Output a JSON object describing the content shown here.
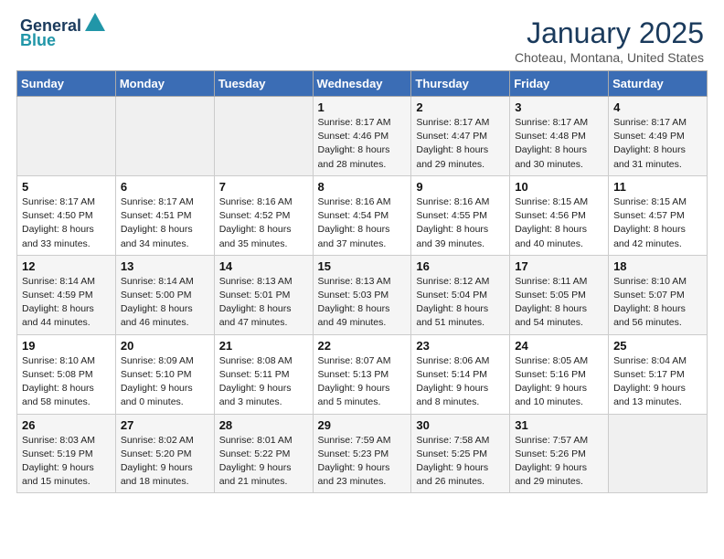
{
  "header": {
    "logo_line1": "General",
    "logo_line2": "Blue",
    "month": "January 2025",
    "location": "Choteau, Montana, United States"
  },
  "days_of_week": [
    "Sunday",
    "Monday",
    "Tuesday",
    "Wednesday",
    "Thursday",
    "Friday",
    "Saturday"
  ],
  "weeks": [
    [
      {
        "day": "",
        "info": ""
      },
      {
        "day": "",
        "info": ""
      },
      {
        "day": "",
        "info": ""
      },
      {
        "day": "1",
        "info": "Sunrise: 8:17 AM\nSunset: 4:46 PM\nDaylight: 8 hours\nand 28 minutes."
      },
      {
        "day": "2",
        "info": "Sunrise: 8:17 AM\nSunset: 4:47 PM\nDaylight: 8 hours\nand 29 minutes."
      },
      {
        "day": "3",
        "info": "Sunrise: 8:17 AM\nSunset: 4:48 PM\nDaylight: 8 hours\nand 30 minutes."
      },
      {
        "day": "4",
        "info": "Sunrise: 8:17 AM\nSunset: 4:49 PM\nDaylight: 8 hours\nand 31 minutes."
      }
    ],
    [
      {
        "day": "5",
        "info": "Sunrise: 8:17 AM\nSunset: 4:50 PM\nDaylight: 8 hours\nand 33 minutes."
      },
      {
        "day": "6",
        "info": "Sunrise: 8:17 AM\nSunset: 4:51 PM\nDaylight: 8 hours\nand 34 minutes."
      },
      {
        "day": "7",
        "info": "Sunrise: 8:16 AM\nSunset: 4:52 PM\nDaylight: 8 hours\nand 35 minutes."
      },
      {
        "day": "8",
        "info": "Sunrise: 8:16 AM\nSunset: 4:54 PM\nDaylight: 8 hours\nand 37 minutes."
      },
      {
        "day": "9",
        "info": "Sunrise: 8:16 AM\nSunset: 4:55 PM\nDaylight: 8 hours\nand 39 minutes."
      },
      {
        "day": "10",
        "info": "Sunrise: 8:15 AM\nSunset: 4:56 PM\nDaylight: 8 hours\nand 40 minutes."
      },
      {
        "day": "11",
        "info": "Sunrise: 8:15 AM\nSunset: 4:57 PM\nDaylight: 8 hours\nand 42 minutes."
      }
    ],
    [
      {
        "day": "12",
        "info": "Sunrise: 8:14 AM\nSunset: 4:59 PM\nDaylight: 8 hours\nand 44 minutes."
      },
      {
        "day": "13",
        "info": "Sunrise: 8:14 AM\nSunset: 5:00 PM\nDaylight: 8 hours\nand 46 minutes."
      },
      {
        "day": "14",
        "info": "Sunrise: 8:13 AM\nSunset: 5:01 PM\nDaylight: 8 hours\nand 47 minutes."
      },
      {
        "day": "15",
        "info": "Sunrise: 8:13 AM\nSunset: 5:03 PM\nDaylight: 8 hours\nand 49 minutes."
      },
      {
        "day": "16",
        "info": "Sunrise: 8:12 AM\nSunset: 5:04 PM\nDaylight: 8 hours\nand 51 minutes."
      },
      {
        "day": "17",
        "info": "Sunrise: 8:11 AM\nSunset: 5:05 PM\nDaylight: 8 hours\nand 54 minutes."
      },
      {
        "day": "18",
        "info": "Sunrise: 8:10 AM\nSunset: 5:07 PM\nDaylight: 8 hours\nand 56 minutes."
      }
    ],
    [
      {
        "day": "19",
        "info": "Sunrise: 8:10 AM\nSunset: 5:08 PM\nDaylight: 8 hours\nand 58 minutes."
      },
      {
        "day": "20",
        "info": "Sunrise: 8:09 AM\nSunset: 5:10 PM\nDaylight: 9 hours\nand 0 minutes."
      },
      {
        "day": "21",
        "info": "Sunrise: 8:08 AM\nSunset: 5:11 PM\nDaylight: 9 hours\nand 3 minutes."
      },
      {
        "day": "22",
        "info": "Sunrise: 8:07 AM\nSunset: 5:13 PM\nDaylight: 9 hours\nand 5 minutes."
      },
      {
        "day": "23",
        "info": "Sunrise: 8:06 AM\nSunset: 5:14 PM\nDaylight: 9 hours\nand 8 minutes."
      },
      {
        "day": "24",
        "info": "Sunrise: 8:05 AM\nSunset: 5:16 PM\nDaylight: 9 hours\nand 10 minutes."
      },
      {
        "day": "25",
        "info": "Sunrise: 8:04 AM\nSunset: 5:17 PM\nDaylight: 9 hours\nand 13 minutes."
      }
    ],
    [
      {
        "day": "26",
        "info": "Sunrise: 8:03 AM\nSunset: 5:19 PM\nDaylight: 9 hours\nand 15 minutes."
      },
      {
        "day": "27",
        "info": "Sunrise: 8:02 AM\nSunset: 5:20 PM\nDaylight: 9 hours\nand 18 minutes."
      },
      {
        "day": "28",
        "info": "Sunrise: 8:01 AM\nSunset: 5:22 PM\nDaylight: 9 hours\nand 21 minutes."
      },
      {
        "day": "29",
        "info": "Sunrise: 7:59 AM\nSunset: 5:23 PM\nDaylight: 9 hours\nand 23 minutes."
      },
      {
        "day": "30",
        "info": "Sunrise: 7:58 AM\nSunset: 5:25 PM\nDaylight: 9 hours\nand 26 minutes."
      },
      {
        "day": "31",
        "info": "Sunrise: 7:57 AM\nSunset: 5:26 PM\nDaylight: 9 hours\nand 29 minutes."
      },
      {
        "day": "",
        "info": ""
      }
    ]
  ]
}
